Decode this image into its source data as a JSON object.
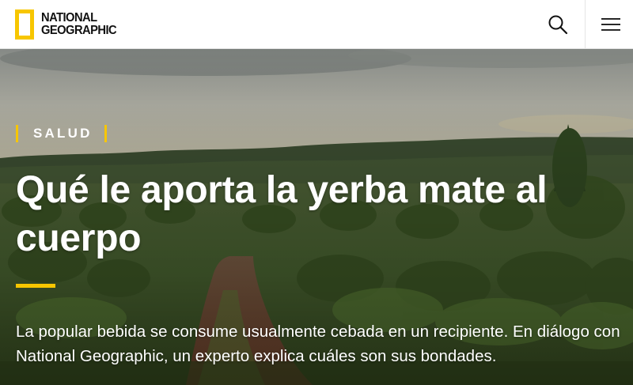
{
  "header": {
    "logo_line1": "NATIONAL",
    "logo_line2": "GEOGRAPHIC",
    "search_icon": "search-icon",
    "menu_icon": "hamburger-menu-icon",
    "brand_color": "#f7c600"
  },
  "hero": {
    "kicker": "SALUD",
    "headline": "Qué le aporta la yerba mate al cuerpo",
    "dek": "La popular bebida se consume usualmente cebada en un recipiente. En diálogo con National Geographic, un experto explica cuáles son sus bondades."
  }
}
